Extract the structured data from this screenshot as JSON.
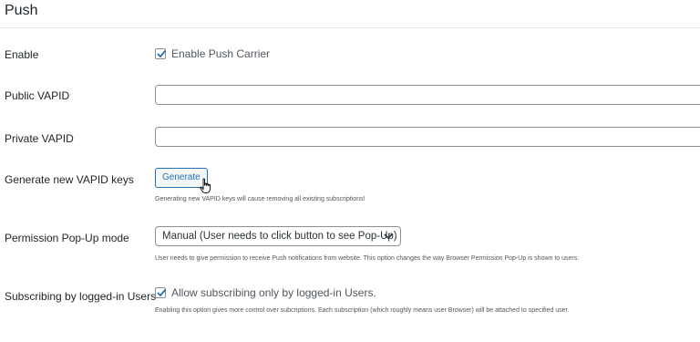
{
  "section": {
    "title": "Push"
  },
  "fields": {
    "enable": {
      "label": "Enable",
      "checkbox_label": "Enable Push Carrier",
      "checked": true
    },
    "public_vapid": {
      "label": "Public VAPID",
      "value": ""
    },
    "private_vapid": {
      "label": "Private VAPID",
      "value": ""
    },
    "generate": {
      "label": "Generate new VAPID keys",
      "button_label": "Generate",
      "help": "Generating new VAPID keys will cause removing all existing subscriptions!"
    },
    "popup_mode": {
      "label": "Permission Pop-Up mode",
      "selected": "Manual (User needs to click button to see Pop-Up)",
      "help": "User needs to give permission to receive Push notifications from website. This option changes the way Browser Permission Pop-Up is shown to users."
    },
    "logged_in": {
      "label": "Subscribing by logged-in Users",
      "checkbox_label": "Allow subscribing only by logged-in Users.",
      "checked": true,
      "help": "Enabling this option gives more control over subcriptions. Each subscription (which roughly means user Browser) will be attached to specified user."
    }
  },
  "colors": {
    "accent": "#2271b1",
    "border": "#8c8f94",
    "text": "#1d2327",
    "muted": "#50575e"
  },
  "icons": {
    "checkmark": "checkmark-icon",
    "chevron": "chevron-down-icon",
    "cursor": "hand-pointer-icon"
  }
}
